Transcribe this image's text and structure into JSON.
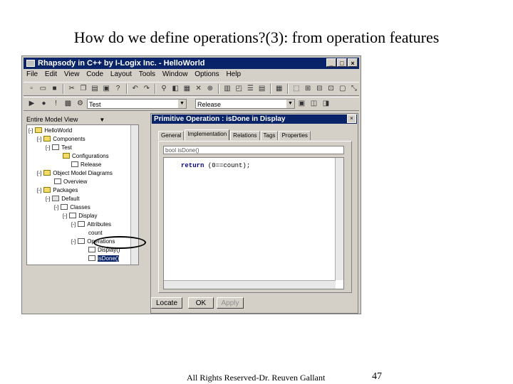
{
  "slide": {
    "title": "How do we define operations?(3): from operation features",
    "footer": "All Rights Reserved-Dr. Reuven Gallant",
    "page_number": "47"
  },
  "app": {
    "title": "Rhapsody in C++ by I-Logix Inc. - HelloWorld",
    "window_buttons": [
      "_",
      "□",
      "×"
    ],
    "menu": [
      "File",
      "Edit",
      "View",
      "Code",
      "Layout",
      "Tools",
      "Window",
      "Options",
      "Help"
    ],
    "combo_config": "Test",
    "combo_release": "Release"
  },
  "browser": {
    "header": "Entire Model View",
    "tree": [
      {
        "label": "HelloWorld",
        "pm": "[-]"
      },
      {
        "label": "Components",
        "pm": "[-]"
      },
      {
        "label": "Test",
        "pm": "[-]"
      },
      {
        "label": "Configurations",
        "pm": ""
      },
      {
        "label": "Release",
        "pm": ""
      },
      {
        "label": "Object Model Diagrams",
        "pm": "[-]"
      },
      {
        "label": "Overview",
        "pm": ""
      },
      {
        "label": "Packages",
        "pm": "[-]"
      },
      {
        "label": "Default",
        "pm": "[-]"
      },
      {
        "label": "Classes",
        "pm": "[-]"
      },
      {
        "label": "Display",
        "pm": "[-]"
      },
      {
        "label": "Attributes",
        "pm": "[-]"
      },
      {
        "label": "count",
        "pm": ""
      },
      {
        "label": "Operations",
        "pm": "[-]"
      },
      {
        "label": "Display()",
        "pm": ""
      },
      {
        "label": "isDone()",
        "pm": ""
      }
    ]
  },
  "dialog": {
    "title": "Primitive Operation : isDone in Display",
    "tabs": [
      "General",
      "Implementation",
      "Relations",
      "Tags",
      "Properties"
    ],
    "signature": "bool isDone()",
    "code_keyword": "return",
    "code_rest": " (0==count);",
    "buttons": {
      "locate": "Locate",
      "ok": "OK",
      "apply": "Apply"
    }
  }
}
